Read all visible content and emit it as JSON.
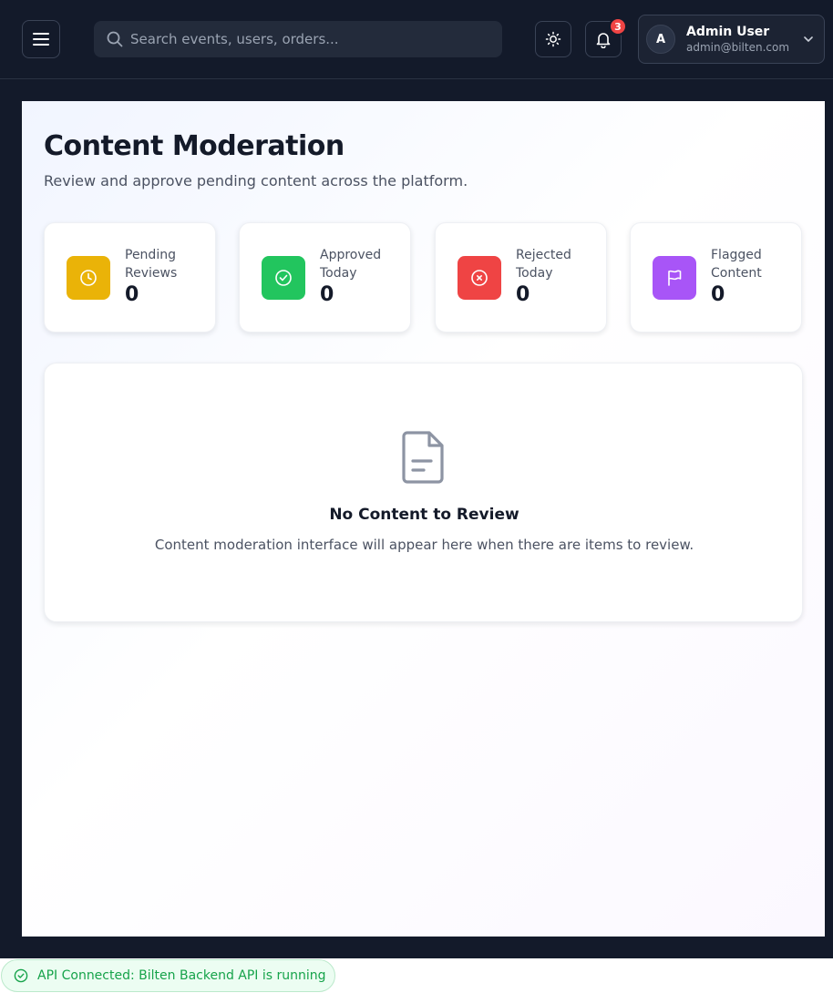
{
  "header": {
    "search_placeholder": "Search events, users, orders...",
    "notification_count": "3",
    "user": {
      "initial": "A",
      "name": "Admin User",
      "email": "admin@bilten.com"
    }
  },
  "page": {
    "title": "Content Moderation",
    "subtitle": "Review and approve pending content across the platform."
  },
  "stats": [
    {
      "label": "Pending Reviews",
      "value": "0",
      "icon": "clock-icon",
      "color": "#eab308"
    },
    {
      "label": "Approved Today",
      "value": "0",
      "icon": "check-circle-icon",
      "color": "#22c55e"
    },
    {
      "label": "Rejected Today",
      "value": "0",
      "icon": "x-circle-icon",
      "color": "#ef4444"
    },
    {
      "label": "Flagged Content",
      "value": "0",
      "icon": "flag-icon",
      "color": "#a855f7"
    }
  ],
  "empty_state": {
    "icon": "document-icon",
    "title": "No Content to Review",
    "description": "Content moderation interface will appear here when there are items to review."
  },
  "api_status": {
    "icon": "check-circle-icon",
    "text": "API Connected: Bilten Backend API is running",
    "color": "#16a34a"
  }
}
